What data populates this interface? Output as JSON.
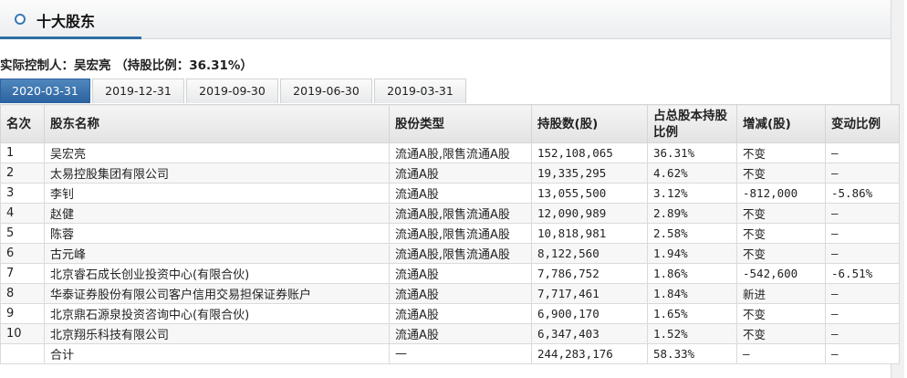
{
  "header": {
    "title": "十大股东"
  },
  "controller": {
    "text": "实际控制人：吴宏亮 （持股比例：36.31%）"
  },
  "tabs": [
    "2020-03-31",
    "2019-12-31",
    "2019-09-30",
    "2019-06-30",
    "2019-03-31"
  ],
  "active_tab": "2020-03-31",
  "table": {
    "headers": [
      "名次",
      "股东名称",
      "股份类型",
      "持股数(股)",
      "占总股本持股比例",
      "增减(股)",
      "变动比例"
    ],
    "rows": [
      [
        "1",
        "吴宏亮",
        "流通A股,限售流通A股",
        "152,108,065",
        "36.31%",
        "不变",
        "—"
      ],
      [
        "2",
        "太易控股集团有限公司",
        "流通A股",
        "19,335,295",
        "4.62%",
        "不变",
        "—"
      ],
      [
        "3",
        "李钊",
        "流通A股",
        "13,055,500",
        "3.12%",
        "-812,000",
        "-5.86%"
      ],
      [
        "4",
        "赵健",
        "流通A股,限售流通A股",
        "12,090,989",
        "2.89%",
        "不变",
        "—"
      ],
      [
        "5",
        "陈蓉",
        "流通A股,限售流通A股",
        "10,818,981",
        "2.58%",
        "不变",
        "—"
      ],
      [
        "6",
        "古元峰",
        "流通A股,限售流通A股",
        "8,122,560",
        "1.94%",
        "不变",
        "—"
      ],
      [
        "7",
        "北京睿石成长创业投资中心(有限合伙)",
        "流通A股",
        "7,786,752",
        "1.86%",
        "-542,600",
        "-6.51%"
      ],
      [
        "8",
        "华泰证券股份有限公司客户信用交易担保证券账户",
        "流通A股",
        "7,717,461",
        "1.84%",
        "新进",
        "—"
      ],
      [
        "9",
        "北京鼎石源泉投资咨询中心(有限合伙)",
        "流通A股",
        "6,900,170",
        "1.65%",
        "不变",
        "—"
      ],
      [
        "10",
        "北京翔乐科技有限公司",
        "流通A股",
        "6,347,403",
        "1.52%",
        "不变",
        "—"
      ],
      [
        "",
        "合计",
        "—",
        "244,283,176",
        "58.33%",
        "—",
        "—"
      ]
    ]
  }
}
